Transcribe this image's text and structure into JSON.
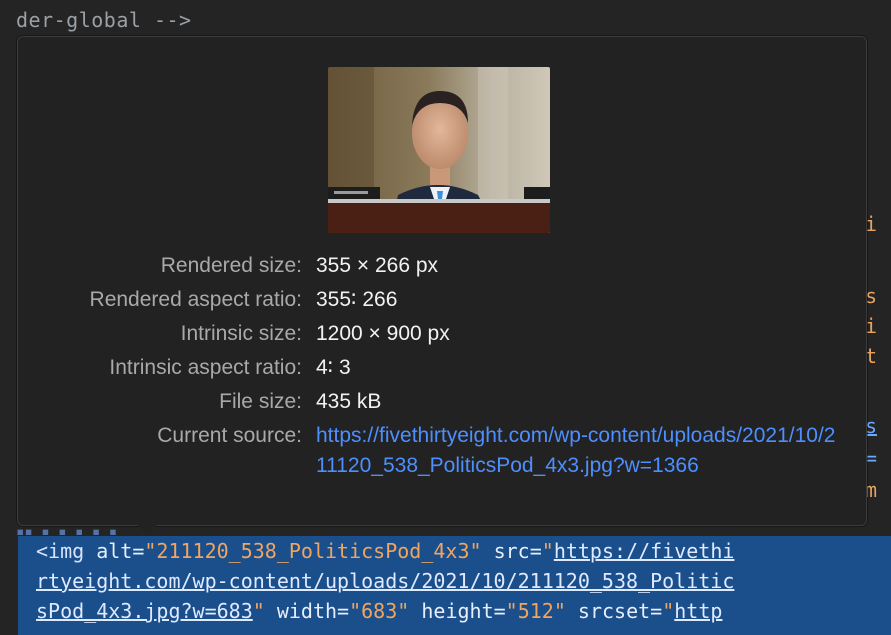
{
  "background_code": {
    "top_comment": "der-global -->",
    "right_fragments": [
      "fi",
      "s",
      "i",
      "t",
      "ws",
      "=",
      "m"
    ]
  },
  "tooltip": {
    "thumbnail_alt": "Portrait photo of a man in a suit at a hearing",
    "rows": [
      {
        "label": "Rendered size:",
        "value": "355 × 266 px"
      },
      {
        "label": "Rendered aspect ratio:",
        "value": "355∶ 266"
      },
      {
        "label": "Intrinsic size:",
        "value": "1200 × 900 px"
      },
      {
        "label": "Intrinsic aspect ratio:",
        "value": "4∶ 3"
      },
      {
        "label": "File size:",
        "value": "435 kB"
      }
    ],
    "current_source_label": "Current source:",
    "current_source_url": "https://fivethirtyeight.com/wp-content/uploads/2021/10/211120_538_PoliticsPod_4x3.jpg?w=1366"
  },
  "selected_element": {
    "line1": {
      "tag_open": "<img",
      "alt_attr": "alt=",
      "alt_value": "\"211120_538_PoliticsPod_4x3\"",
      "src_attr": "src=",
      "src_value_start": "\"https://fivethi"
    },
    "line2": {
      "src_value_middle": "rtyeight.com/wp-content/uploads/2021/10/211120_538_Politic"
    },
    "line3": {
      "src_value_end": "sPod_4x3.jpg?w=683",
      "quote": "\"",
      "width_attr": "width=",
      "width_value": "\"683\"",
      "height_attr": "height=",
      "height_value": "\"512\"",
      "srcset_attr": "srcset=",
      "srcset_value": "\"http"
    }
  },
  "colors": {
    "panel_bg": "#222222",
    "label_gray": "#a9a9a9",
    "link_blue": "#4d8fff",
    "selection_blue": "#1a4f8c",
    "string_orange": "#f0a561"
  }
}
